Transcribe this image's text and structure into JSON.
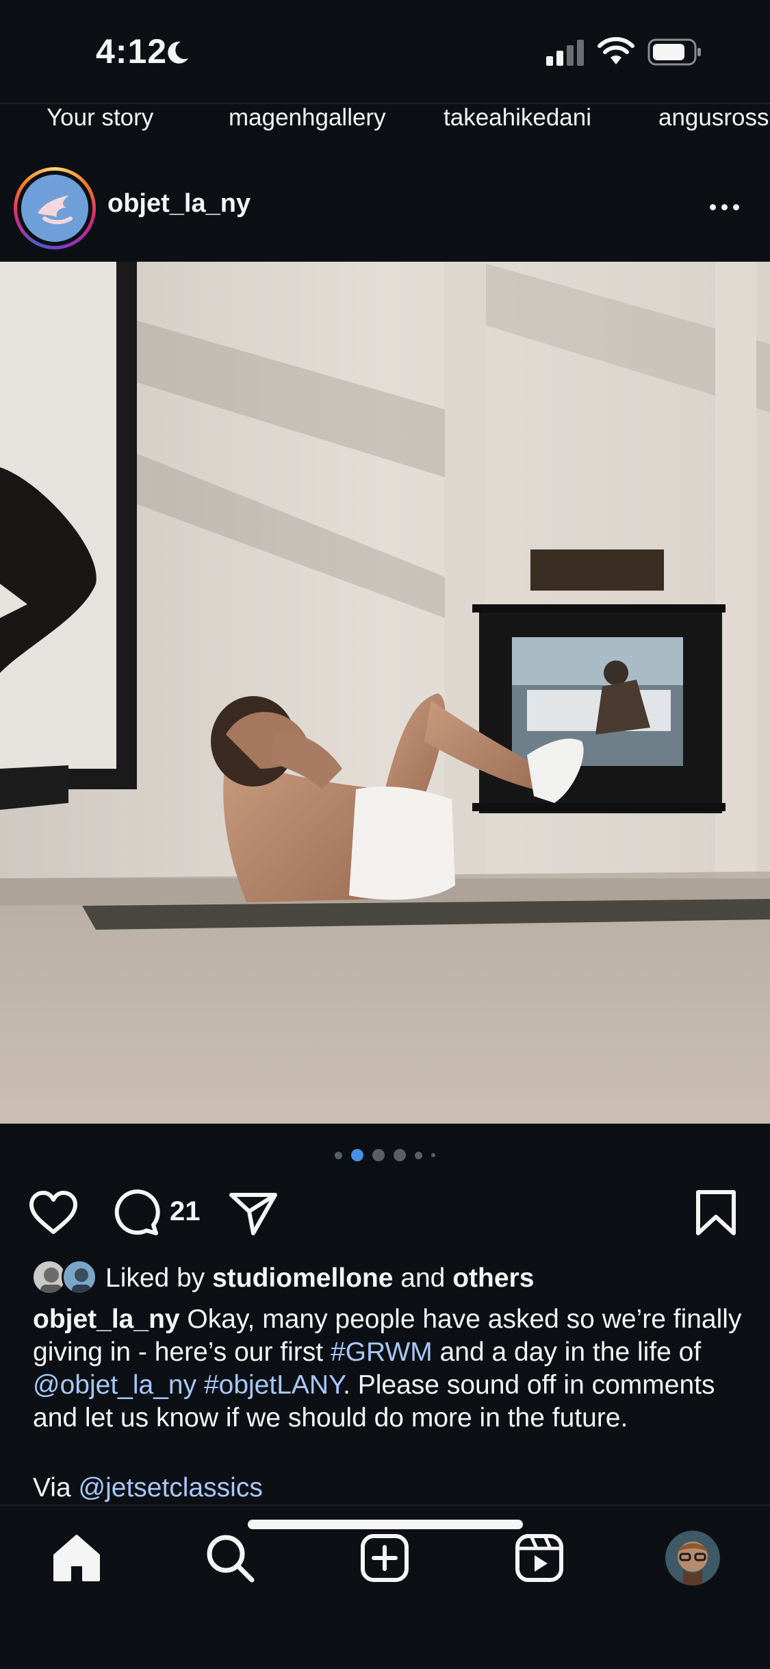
{
  "status_bar": {
    "time": "4:12",
    "icons": [
      "moon-icon",
      "cellular-signal-icon",
      "wifi-icon",
      "battery-icon"
    ]
  },
  "stories": [
    {
      "label": "Your story"
    },
    {
      "label": "magenhgallery"
    },
    {
      "label": "takeahikedani"
    },
    {
      "label": "angusross"
    }
  ],
  "post": {
    "username": "objet_la_ny",
    "carousel": {
      "count": 6,
      "active_index": 1
    },
    "comment_count": "21",
    "likes": {
      "prefix": "Liked by ",
      "user": "studiomellone",
      "middle": " and ",
      "suffix": "others"
    },
    "caption": {
      "author": "objet_la_ny",
      "part1": " Okay, many people have asked so we’re finally giving in - here’s our first ",
      "hashtag1": "#GRWM",
      "part2": " and a day in the life of ",
      "mention1": "@objet_la_ny",
      "space": " ",
      "hashtag2": "#objetLANY",
      "part3": ". Please sound off in comments and let us know if we should do more in the future.",
      "via_prefix": "Via ",
      "via_mention": "@jetsetclassics"
    }
  },
  "colors": {
    "background": "#0c1014",
    "text": "#f5f5f5",
    "link": "#a8c7fa",
    "active_dot": "#4a90e2"
  },
  "bottom_nav": [
    "home-icon",
    "search-icon",
    "create-icon",
    "reels-icon",
    "profile-avatar"
  ]
}
